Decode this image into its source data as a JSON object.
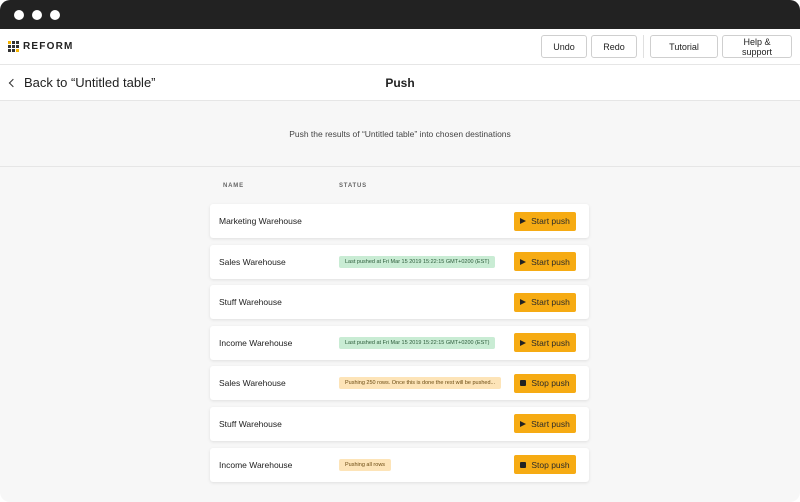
{
  "app": {
    "logo_text": "REFORM"
  },
  "toolbar": {
    "undo_label": "Undo",
    "redo_label": "Redo",
    "tutorial_label": "Tutorial",
    "help_label": "Help & support"
  },
  "subheader": {
    "back_label": "Back to “Untitled table”",
    "title": "Push"
  },
  "intro": {
    "text": "Push the results of “Untitled table” into chosen destinations"
  },
  "table": {
    "columns": {
      "name": "NAME",
      "status": "STATUS"
    },
    "rows": [
      {
        "name": "Marketing Warehouse",
        "status": "",
        "status_type": "none",
        "action": "Start push",
        "action_icon": "play-icon"
      },
      {
        "name": "Sales Warehouse",
        "status": "Last pushed at Fri Mar 15 2019 15:22:15 GMT+0200 (EST)",
        "status_type": "green",
        "action": "Start push",
        "action_icon": "play-icon"
      },
      {
        "name": "Stuff Warehouse",
        "status": "",
        "status_type": "none",
        "action": "Start push",
        "action_icon": "play-icon"
      },
      {
        "name": "Income Warehouse",
        "status": "Last pushed at Fri Mar 15 2019 15:22:15 GMT+0200 (EST)",
        "status_type": "green",
        "action": "Start push",
        "action_icon": "play-icon"
      },
      {
        "name": "Sales Warehouse",
        "status": "Pushing 250 rows. Once this is done the rest will be pushed...",
        "status_type": "yellow",
        "action": "Stop push",
        "action_icon": "stop-icon"
      },
      {
        "name": "Stuff Warehouse",
        "status": "",
        "status_type": "none",
        "action": "Start push",
        "action_icon": "play-icon"
      },
      {
        "name": "Income Warehouse",
        "status": "Pushing all rows",
        "status_type": "yellow",
        "action": "Stop push",
        "action_icon": "stop-icon"
      }
    ]
  },
  "colors": {
    "accent": "#f6ab13",
    "status_green_bg": "#c9ecd4",
    "status_yellow_bg": "#fde4b8",
    "titlebar": "#222222"
  }
}
